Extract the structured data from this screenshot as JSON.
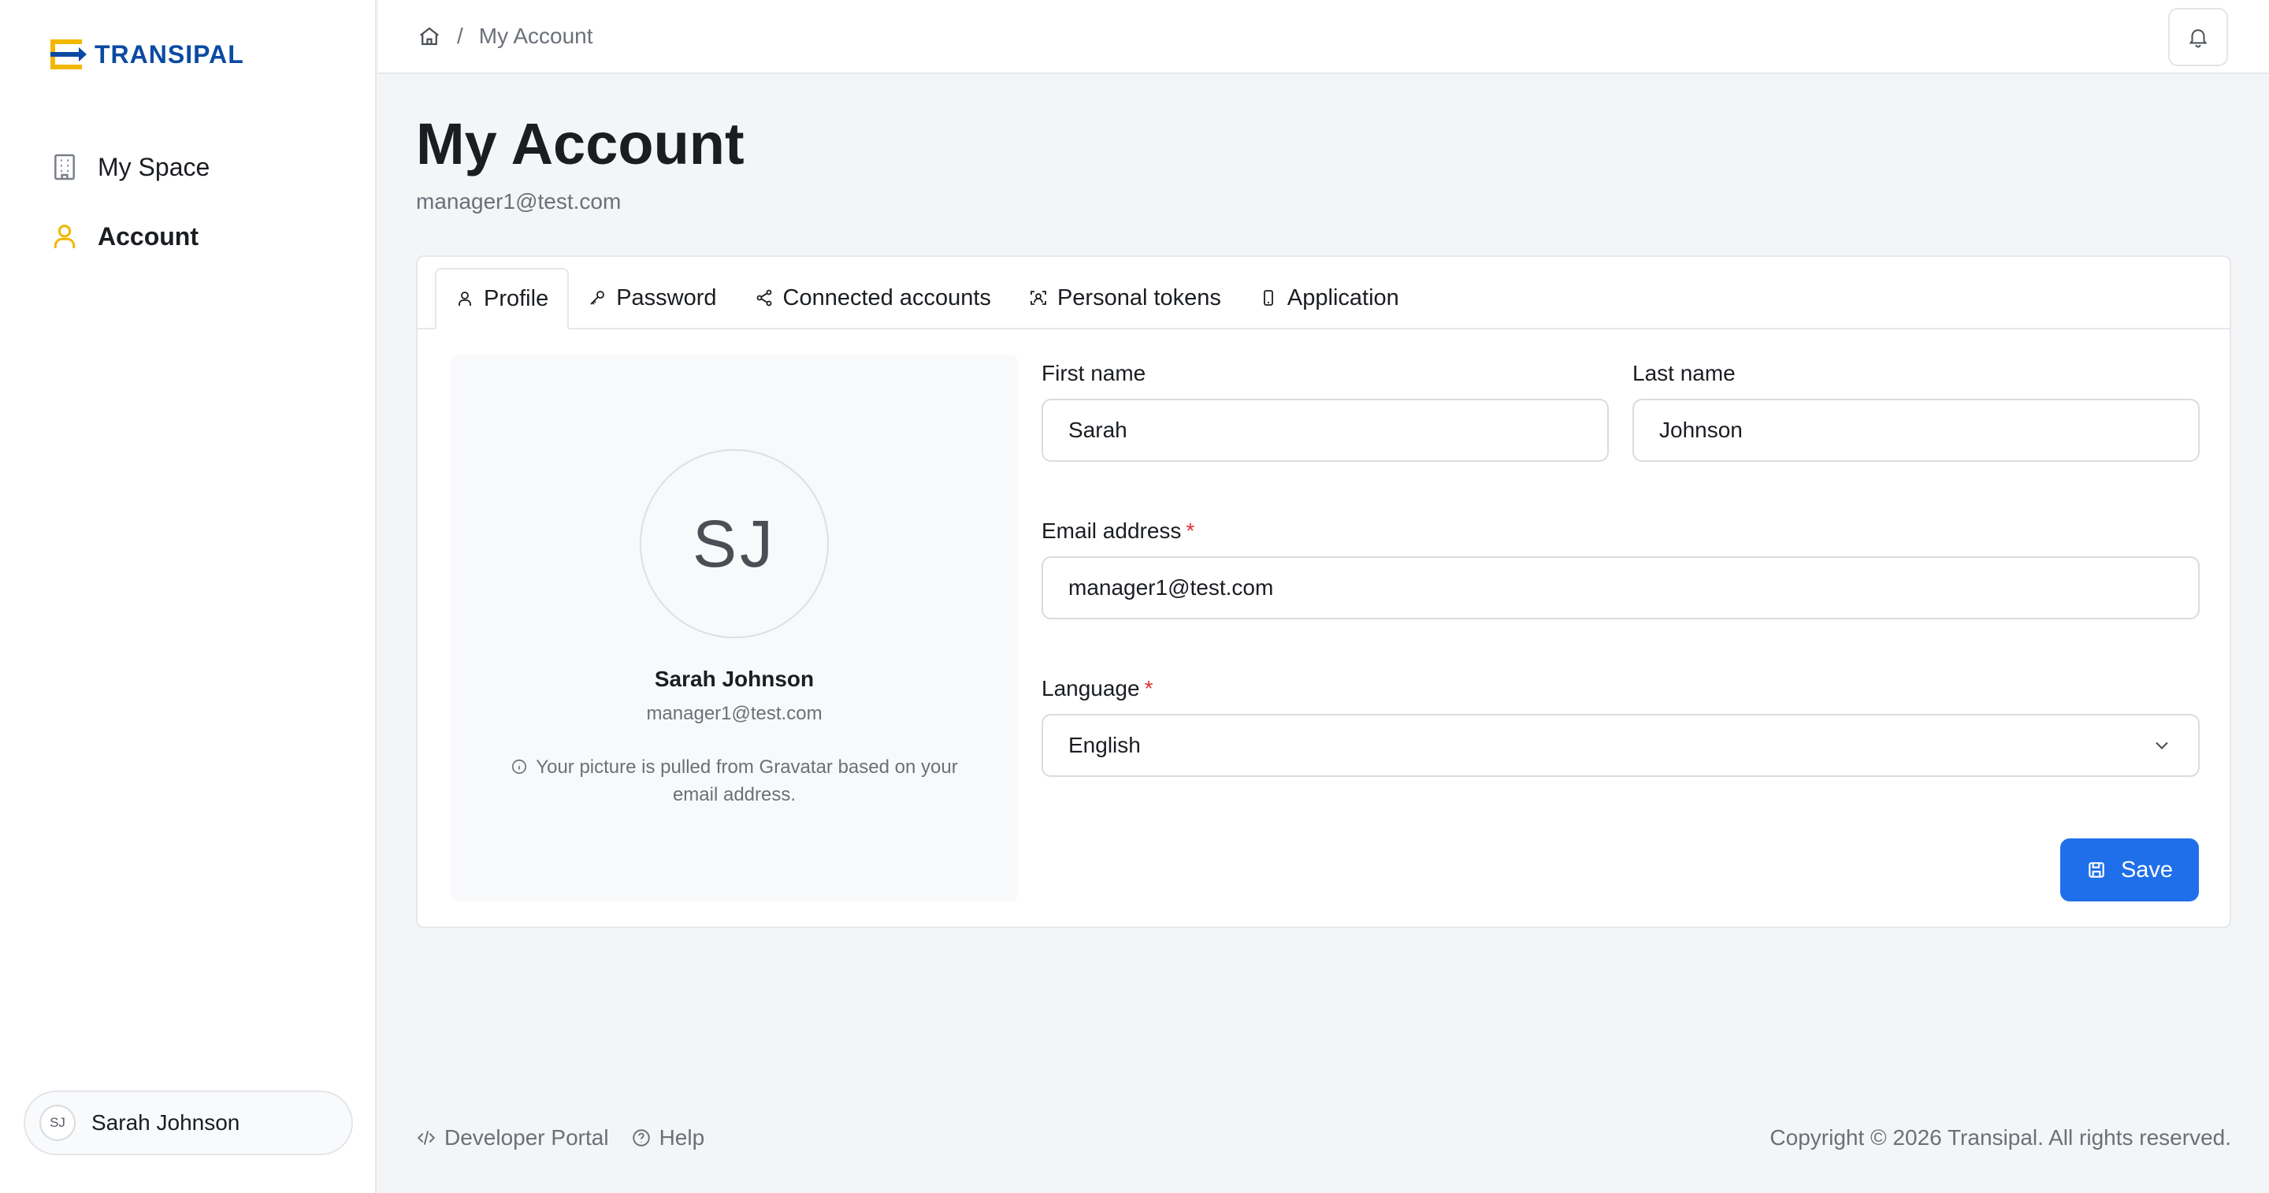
{
  "brand": {
    "name": "TRANSIPAL"
  },
  "sidebar": {
    "items": [
      {
        "label": "My Space",
        "icon": "building-icon",
        "active": false
      },
      {
        "label": "Account",
        "icon": "user-icon",
        "active": true
      }
    ],
    "user": {
      "initials": "SJ",
      "name": "Sarah Johnson"
    }
  },
  "topbar": {
    "breadcrumb": {
      "home_icon": "home-icon",
      "separator": "/",
      "current": "My Account"
    },
    "notifications_icon": "bell-icon"
  },
  "page": {
    "title": "My Account",
    "subtitle": "manager1@test.com"
  },
  "tabs": [
    {
      "label": "Profile",
      "icon": "user-icon",
      "active": true
    },
    {
      "label": "Password",
      "icon": "key-icon",
      "active": false
    },
    {
      "label": "Connected accounts",
      "icon": "share-icon",
      "active": false
    },
    {
      "label": "Personal tokens",
      "icon": "token-icon",
      "active": false
    },
    {
      "label": "Application",
      "icon": "phone-icon",
      "active": false
    }
  ],
  "profile": {
    "initials": "SJ",
    "name": "Sarah Johnson",
    "email": "manager1@test.com",
    "note": "Your picture is pulled from Gravatar based on your email address."
  },
  "form": {
    "first_name": {
      "label": "First name",
      "value": "Sarah"
    },
    "last_name": {
      "label": "Last name",
      "value": "Johnson"
    },
    "email": {
      "label": "Email address",
      "required_mark": "*",
      "value": "manager1@test.com"
    },
    "language": {
      "label": "Language",
      "required_mark": "*",
      "value": "English"
    },
    "save_label": "Save"
  },
  "footer": {
    "developer_portal": "Developer Portal",
    "help": "Help",
    "copyright": "Copyright © 2026 Transipal. All rights reserved."
  },
  "colors": {
    "brand_blue": "#0b4aa2",
    "brand_yellow": "#f2b705",
    "primary_button": "#1f6fea",
    "required": "#e03131"
  }
}
